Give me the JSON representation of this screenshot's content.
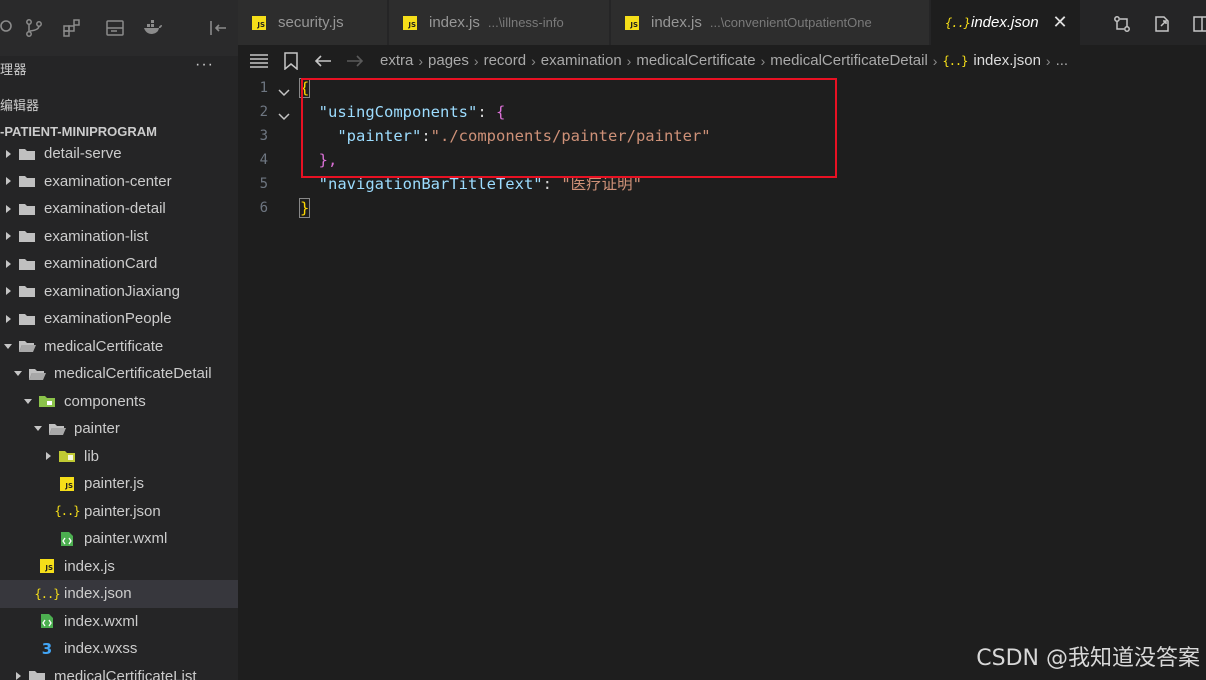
{
  "activity_bar": {
    "icons": [
      "search-icon",
      "source-control-icon",
      "extensions-icon",
      "storage-icon",
      "docker-icon",
      "collapse-panel-icon"
    ]
  },
  "explorer": {
    "title": "理器",
    "open_editors_label": "编辑器",
    "project_name": "-PATIENT-MINIPROGRAM",
    "tree": [
      {
        "label": "detail-serve",
        "type": "folder",
        "expanded": false,
        "depth": 0
      },
      {
        "label": "examination-center",
        "type": "folder",
        "expanded": false,
        "depth": 0
      },
      {
        "label": "examination-detail",
        "type": "folder",
        "expanded": false,
        "depth": 0
      },
      {
        "label": "examination-list",
        "type": "folder",
        "expanded": false,
        "depth": 0
      },
      {
        "label": "examinationCard",
        "type": "folder",
        "expanded": false,
        "depth": 0
      },
      {
        "label": "examinationJiaxiang",
        "type": "folder",
        "expanded": false,
        "depth": 0
      },
      {
        "label": "examinationPeople",
        "type": "folder",
        "expanded": false,
        "depth": 0
      },
      {
        "label": "medicalCertificate",
        "type": "folder",
        "expanded": true,
        "depth": 0
      },
      {
        "label": "medicalCertificateDetail",
        "type": "folder",
        "expanded": true,
        "depth": 1
      },
      {
        "label": "components",
        "type": "folder-special",
        "expanded": true,
        "depth": 2
      },
      {
        "label": "painter",
        "type": "folder",
        "expanded": true,
        "depth": 3
      },
      {
        "label": "lib",
        "type": "folder-lib",
        "expanded": false,
        "depth": 4
      },
      {
        "label": "painter.js",
        "type": "js",
        "depth": 4
      },
      {
        "label": "painter.json",
        "type": "json",
        "depth": 4
      },
      {
        "label": "painter.wxml",
        "type": "wxml",
        "depth": 4
      },
      {
        "label": "index.js",
        "type": "js",
        "depth": 2
      },
      {
        "label": "index.json",
        "type": "json",
        "depth": 2,
        "selected": true
      },
      {
        "label": "index.wxml",
        "type": "wxml",
        "depth": 2
      },
      {
        "label": "index.wxss",
        "type": "css",
        "depth": 2
      },
      {
        "label": "medicalCertificateList",
        "type": "folder",
        "expanded": false,
        "depth": 1
      }
    ]
  },
  "tabs": [
    {
      "label": "security.js",
      "desc": "",
      "type": "js",
      "active": false
    },
    {
      "label": "index.js",
      "desc": "...\\illness-info",
      "type": "js",
      "active": false
    },
    {
      "label": "index.js",
      "desc": "...\\convenientOutpatientOne",
      "type": "js",
      "active": false
    },
    {
      "label": "index.json",
      "desc": "",
      "type": "json",
      "active": true,
      "close": "✕"
    }
  ],
  "breadcrumb": {
    "segments": [
      "extra",
      "pages",
      "record",
      "examination",
      "medicalCertificate",
      "medicalCertificateDetail"
    ],
    "file": "index.json",
    "trailing": "..."
  },
  "editor": {
    "lines": [
      {
        "num": "1"
      },
      {
        "num": "2"
      },
      {
        "num": "3"
      },
      {
        "num": "4"
      },
      {
        "num": "5"
      },
      {
        "num": "6"
      }
    ],
    "tokens": {
      "open_brace": "{",
      "using_key": "\"usingComponents\"",
      "colon": ": ",
      "inner_open": "{",
      "painter_key": "\"painter\"",
      "colon2": ":",
      "painter_val": "\"./components/painter/painter\"",
      "inner_close": "},",
      "nav_key": "\"navigationBarTitleText\"",
      "colon3": ": ",
      "nav_val_q1": "\"",
      "nav_val": "医疗证明",
      "nav_val_q2": "\"",
      "close_brace": "}"
    }
  },
  "watermark": "CSDN @我知道没答案",
  "colors": {
    "highlight_box": "#e81123",
    "json_key": "#9cdcfe",
    "json_string": "#ce9178",
    "bracket_gold": "#ffd700",
    "bracket_purple": "#da70d6"
  }
}
